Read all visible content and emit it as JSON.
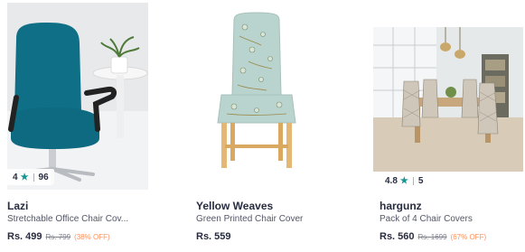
{
  "products": [
    {
      "brand": "Lazi",
      "name": "Stretchable Office Chair Cov...",
      "price": "Rs. 499",
      "mrp": "Rs. 799",
      "discount": "(38% OFF)",
      "rating": "4",
      "rating_count": "96",
      "image_icon": "office-chair-image"
    },
    {
      "brand": "Yellow Weaves",
      "name": "Green Printed Chair Cover",
      "price": "Rs. 559",
      "image_icon": "printed-chair-image"
    },
    {
      "brand": "hargunz",
      "name": "Pack of 4 Chair Covers",
      "price": "Rs. 560",
      "mrp": "Rs. 1699",
      "discount": "(67% OFF)",
      "rating": "4.8",
      "rating_count": "5",
      "image_icon": "dining-chairs-image"
    }
  ],
  "colors": {
    "teal_chair": "#0e6f86",
    "star": "#14958f",
    "discount": "#ff905a",
    "cover_mint": "#b9d3ce"
  }
}
